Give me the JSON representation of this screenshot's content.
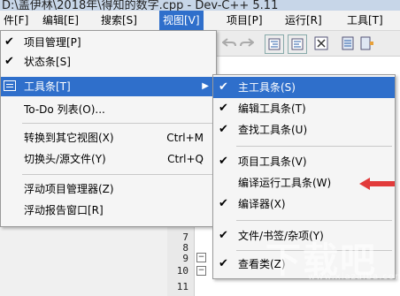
{
  "window": {
    "title": "D:\\盖伊林\\2018年\\得知的数字.cpp - Dev-C++ 5.11"
  },
  "menubar": {
    "items": [
      {
        "label": "件[F]"
      },
      {
        "label": "编辑[E]"
      },
      {
        "label": "搜索[S]"
      },
      {
        "label": "视图[V]"
      },
      {
        "label": "项目[P]"
      },
      {
        "label": "运行[R]"
      },
      {
        "label": "工具[T]"
      }
    ]
  },
  "view_menu": {
    "items": [
      {
        "label": "项目管理[P]",
        "checked": true
      },
      {
        "label": "状态条[S]",
        "checked": true
      },
      {
        "label": "工具条[T]",
        "submenu_arrow": "▶"
      },
      {
        "label": "To-Do 列表(O)..."
      },
      {
        "label": "转换到其它视图(X)",
        "shortcut": "Ctrl+M"
      },
      {
        "label": "切换头/源文件(Y)",
        "shortcut": "Ctrl+Q"
      },
      {
        "label": "浮动项目管理器(Z)"
      },
      {
        "label": "浮动报告窗口[R]"
      }
    ]
  },
  "toolbar_submenu": {
    "items": [
      {
        "label": "主工具条(S)",
        "checked": true
      },
      {
        "label": "编辑工具条(T)",
        "checked": true
      },
      {
        "label": "查找工具条(U)",
        "checked": true
      },
      {
        "label": "项目工具条(V)",
        "checked": true
      },
      {
        "label": "编译运行工具条(W)",
        "checked": false
      },
      {
        "label": "编译器(X)",
        "checked": true
      },
      {
        "label": "文件/书签/杂项(Y)",
        "checked": true
      },
      {
        "label": "查看类(Z)",
        "checked": true
      }
    ]
  },
  "editor": {
    "line_numbers": [
      "7",
      "8",
      "9",
      "10",
      "11"
    ]
  },
  "watermark": {
    "text": "下载吧",
    "sub": "www.xiazaiba.com"
  },
  "colors": {
    "highlight": "#2f6fcb",
    "arrow": "#e23b3b"
  },
  "icons": {
    "check": "✔",
    "submenu_arrow": "▶",
    "fold_minus": "−"
  }
}
